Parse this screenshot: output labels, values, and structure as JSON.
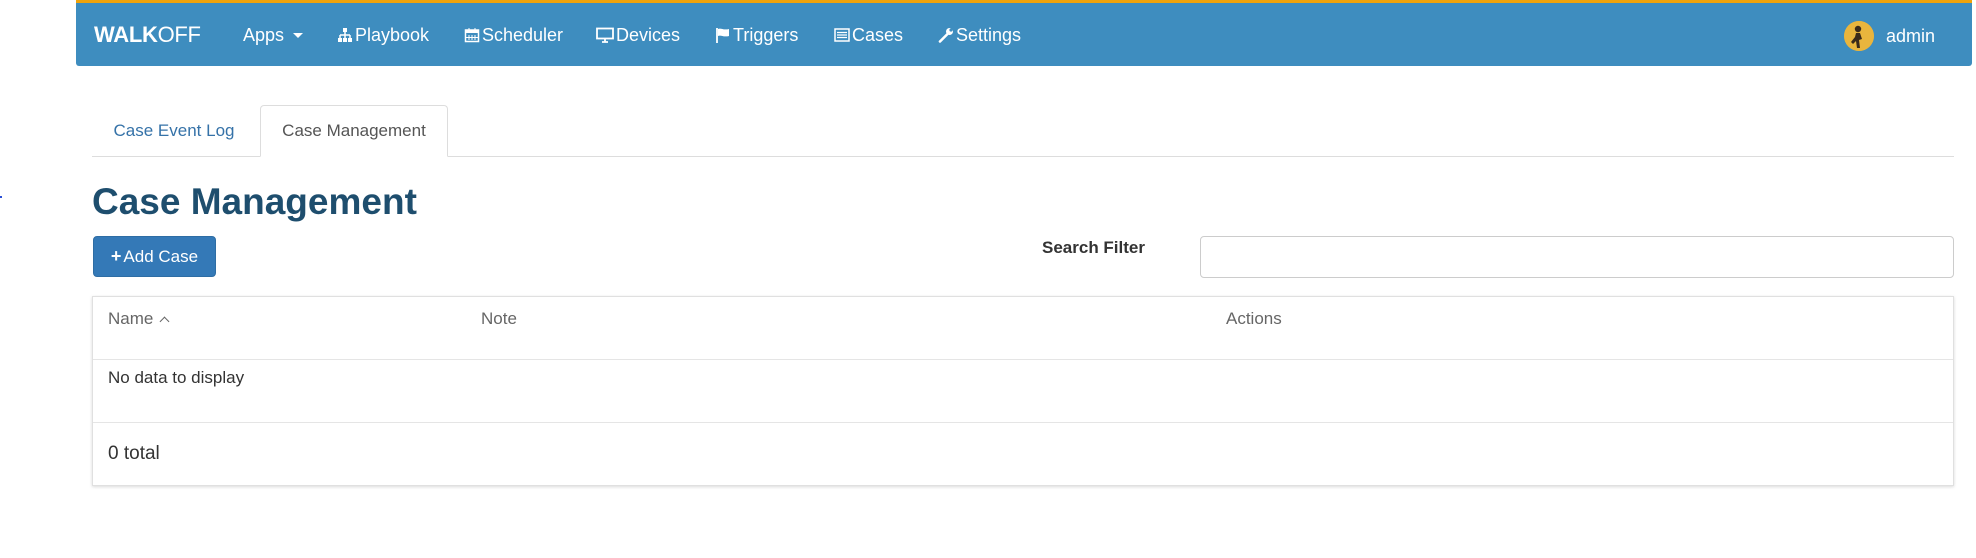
{
  "navbar": {
    "brand_bold": "WALK",
    "brand_rest": "OFF",
    "items": [
      {
        "label": "Apps",
        "icon": "none",
        "has_dropdown": true
      },
      {
        "label": "Playbook",
        "icon": "sitemap-icon"
      },
      {
        "label": "Scheduler",
        "icon": "calendar-icon"
      },
      {
        "label": "Devices",
        "icon": "monitor-icon"
      },
      {
        "label": "Triggers",
        "icon": "flag-icon"
      },
      {
        "label": "Cases",
        "icon": "list-icon"
      },
      {
        "label": "Settings",
        "icon": "wrench-icon"
      }
    ],
    "user": {
      "name": "admin",
      "avatar": "avatar-icon"
    },
    "colors": {
      "bar": "#3e8dbf",
      "accent_top": "#f0a30a"
    }
  },
  "tabs": [
    {
      "label": "Case Event Log",
      "active": false
    },
    {
      "label": "Case Management",
      "active": true
    }
  ],
  "page": {
    "title": "Case Management",
    "add_button_label": "Add Case",
    "search_label": "Search Filter",
    "search_value": ""
  },
  "table": {
    "columns": [
      {
        "label": "Name",
        "sorted": "ascending"
      },
      {
        "label": "Note"
      },
      {
        "label": "Actions"
      }
    ],
    "empty_message": "No data to display",
    "total_text": "0 total"
  }
}
